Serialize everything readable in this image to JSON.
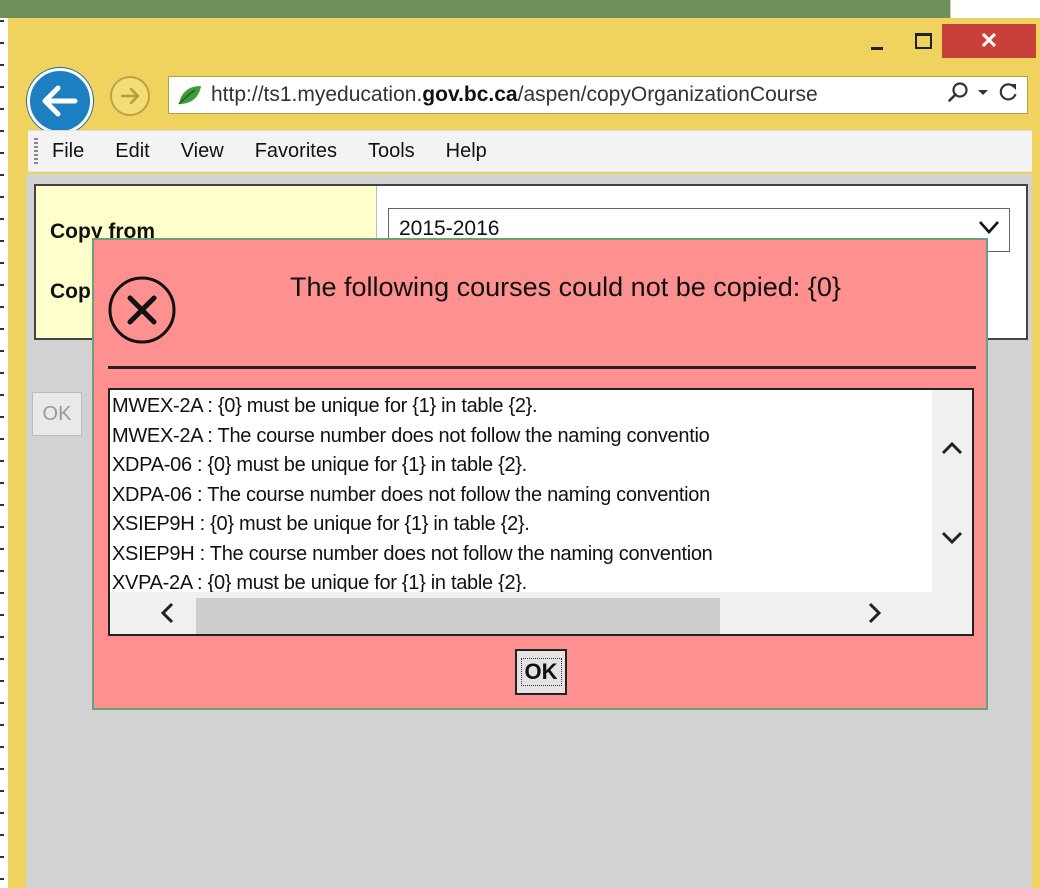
{
  "browser": {
    "url_prefix": "http://ts1.myeducation.",
    "url_domain": "gov.bc.ca",
    "url_path": "/aspen/copyOrganizationCourse",
    "window_close": "✕"
  },
  "menu": {
    "items": [
      "File",
      "Edit",
      "View",
      "Favorites",
      "Tools",
      "Help"
    ]
  },
  "form": {
    "copy_from_label": "Copy from",
    "copy_to_label": "Cop",
    "year_value": "2015-2016",
    "ok_label": "OK"
  },
  "dialog": {
    "title": "The following courses could not be copied: {0}",
    "lines": [
      "MWEX-2A : {0} must be unique for {1} in table {2}.",
      "MWEX-2A : The course number does not follow the naming conventio",
      "XDPA-06 : {0} must be unique for {1} in table {2}.",
      "XDPA-06 : The course number does not follow the naming convention",
      "XSIEP9H : {0} must be unique for {1} in table {2}.",
      "XSIEP9H : The course number does not follow the naming convention",
      "XVPA-2A : {0} must be unique for {1} in table {2}."
    ],
    "ok_label": "OK"
  },
  "colors": {
    "window_frame": "#f0d35f",
    "dialog_bg": "#fe9090",
    "close_button": "#c9403a",
    "back_button": "#1b7fc2",
    "label_column": "#ffffcc"
  },
  "icons": {
    "back": "arrow-left-icon",
    "forward": "arrow-right-icon",
    "site": "leaf-icon",
    "search": "search-icon",
    "refresh": "refresh-icon",
    "error": "error-x-icon"
  }
}
